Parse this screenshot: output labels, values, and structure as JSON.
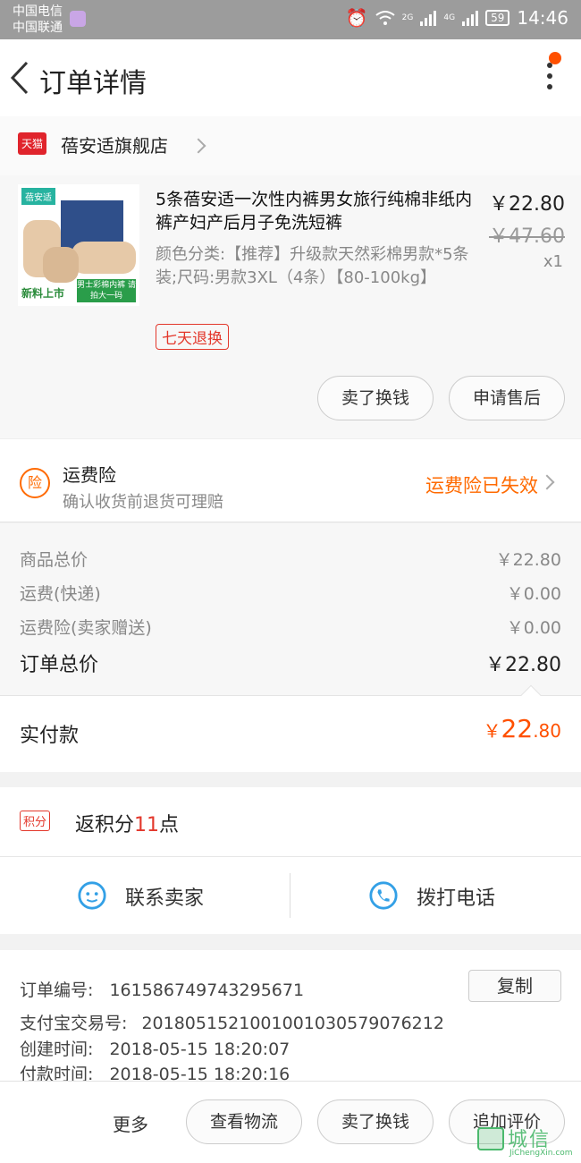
{
  "status_bar": {
    "carrier1": "中国电信",
    "carrier2": "中国联通",
    "net1": "2G",
    "net2": "4G",
    "battery": "59",
    "time": "14:46"
  },
  "header": {
    "title": "订单详情"
  },
  "shop": {
    "badge": "天猫",
    "name": "蓓安适旗舰店"
  },
  "product": {
    "image_brand": "蓓安适",
    "image_new": "新料上市",
    "image_tag": "男士彩棉内裤 请拍大一码",
    "title": "5条蓓安适一次性内裤男女旅行纯棉非纸内裤产妇产后月子免洗短裤",
    "attributes": "颜色分类:【推荐】升级款天然彩棉男款*5条装;尺码:男款3XL（4条）【80-100kg】",
    "price": "￥22.80",
    "original_price": "￥47.60",
    "quantity": "x1",
    "return_tag": "七天退换",
    "btn_sell": "卖了换钱",
    "btn_after_sale": "申请售后"
  },
  "insurance": {
    "icon_text": "险",
    "title": "运费险",
    "subtitle": "确认收货前退货可理赔",
    "status": "运费险已失效"
  },
  "summary": {
    "rows": [
      {
        "label": "商品总价",
        "value": "￥22.80"
      },
      {
        "label": "运费(快递)",
        "value": "￥0.00"
      },
      {
        "label": "运费险(卖家赠送)",
        "value": "￥0.00"
      }
    ],
    "total_label": "订单总价",
    "total_value": "￥22.80",
    "paid_label": "实付款",
    "paid_symbol": "￥",
    "paid_int": "22",
    "paid_dec": ".80"
  },
  "points": {
    "badge": "积分",
    "prefix": "返积分",
    "count": "11",
    "suffix": "点"
  },
  "contact": {
    "seller": "联系卖家",
    "phone": "拨打电话"
  },
  "order_info": {
    "copy_label": "复制",
    "rows": [
      {
        "label": "订单编号:",
        "value": "161586749743295671"
      },
      {
        "label": "支付宝交易号:",
        "value": "2018051521001001030579076212"
      },
      {
        "label": "创建时间:",
        "value": "2018-05-15 18:20:07"
      },
      {
        "label": "付款时间:",
        "value": "2018-05-15 18:20:16"
      }
    ]
  },
  "bottom_bar": {
    "more": "更多",
    "logistics": "查看物流",
    "sell": "卖了换钱",
    "review": "追加评价"
  },
  "watermark": {
    "cn": "城信",
    "en": "JiChengXin.com"
  },
  "colors": {
    "accent": "#ff5000",
    "red": "#e3382c",
    "blue": "#33a0e6",
    "status_bar": "#9c9c9c"
  }
}
